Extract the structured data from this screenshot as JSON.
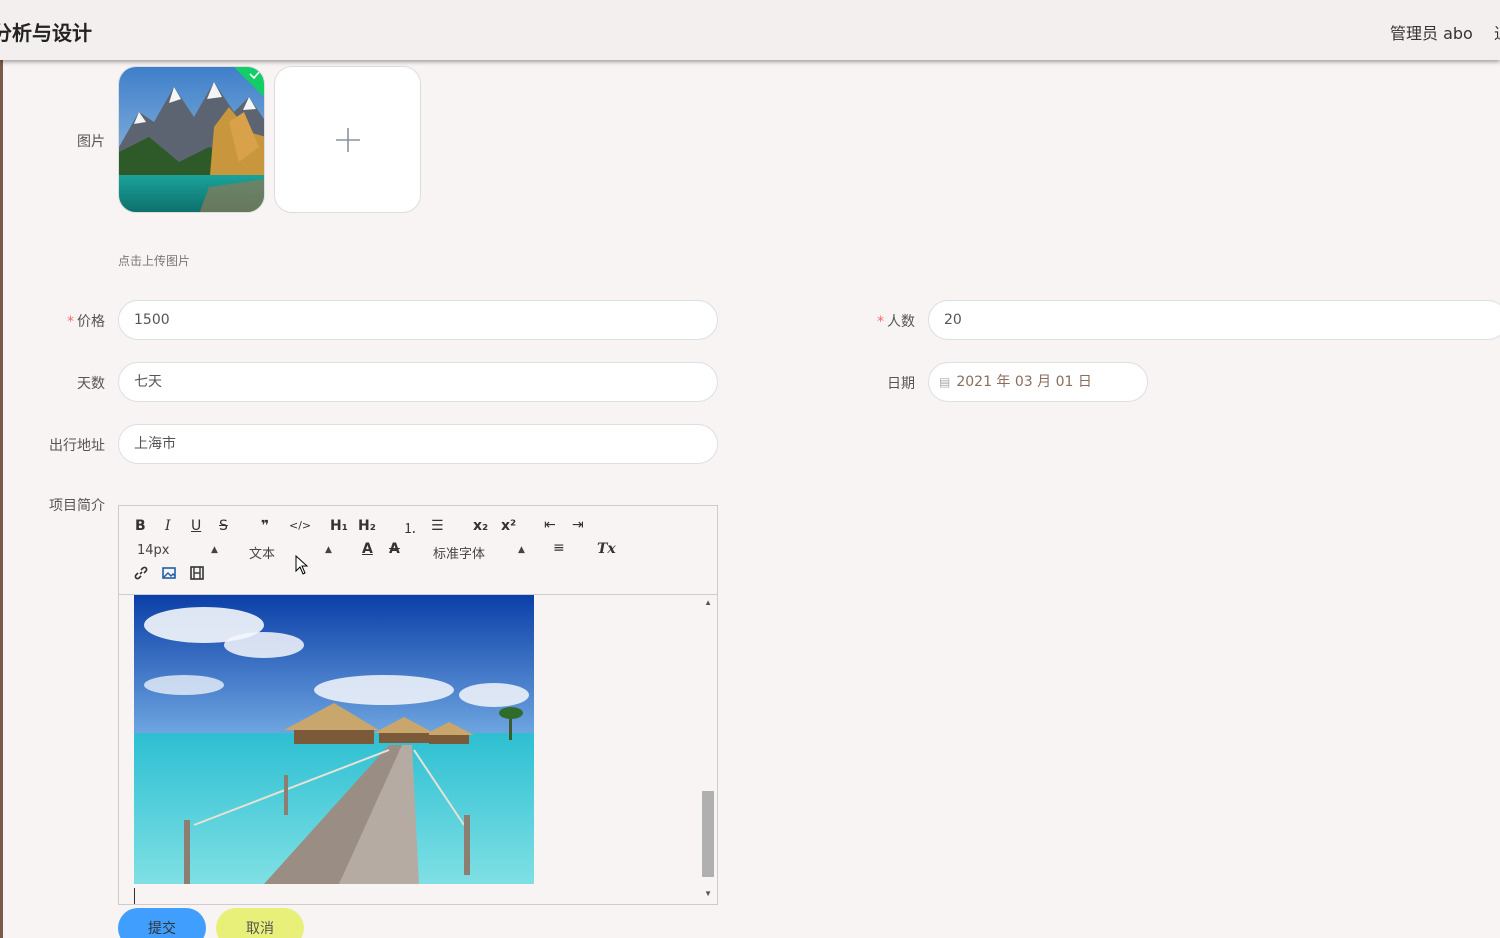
{
  "header": {
    "title": "分析与设计",
    "user": "管理员 abo",
    "extra": "退"
  },
  "form": {
    "image": {
      "label": "图片",
      "tip": "点击上传图片",
      "add_icon": "plus-icon"
    },
    "price": {
      "label": "价格",
      "value": "1500",
      "required": true
    },
    "people": {
      "label": "人数",
      "value": "20",
      "required": true
    },
    "days": {
      "label": "天数",
      "value": "七天"
    },
    "date": {
      "label": "日期",
      "value": "2021 年 03 月 01 日"
    },
    "address": {
      "label": "出行地址",
      "value": "上海市"
    },
    "intro": {
      "label": "项目简介",
      "toolbar": {
        "bold": "B",
        "italic": "I",
        "underline": "U",
        "strike": "S",
        "quote": "❞",
        "code": "</>",
        "h1": "H₁",
        "h2": "H₂",
        "ordered_list": "⒈",
        "bullet_list": "☰",
        "subscript": "x₂",
        "superscript": "x²",
        "outdent": "⇤",
        "indent": "⇥",
        "size_select": "14px",
        "header_select": "文本",
        "font_color": "A",
        "bg_color": "A",
        "font_select": "标准字体",
        "align": "≡",
        "clean": "Tx",
        "link": "link-icon",
        "image": "image-icon",
        "video": "video-icon"
      }
    }
  },
  "buttons": {
    "submit": "提交",
    "cancel": "取消"
  },
  "colors": {
    "primary": "#409eff",
    "cancel": "#e8f07a",
    "required": "#f56c6c",
    "success": "#13ce66"
  }
}
